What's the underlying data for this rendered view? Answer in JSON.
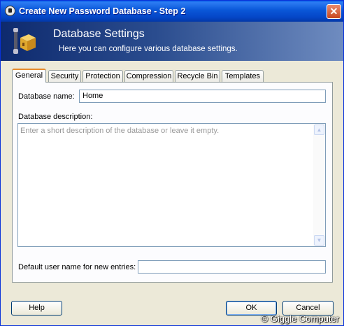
{
  "window": {
    "title": "Create New Password Database - Step 2",
    "close_label": "✕"
  },
  "banner": {
    "title": "Database Settings",
    "subtitle": "Here you can configure various database settings."
  },
  "tabs": [
    {
      "label": "General",
      "active": true
    },
    {
      "label": "Security"
    },
    {
      "label": "Protection"
    },
    {
      "label": "Compression"
    },
    {
      "label": "Recycle Bin"
    },
    {
      "label": "Templates"
    }
  ],
  "general": {
    "db_name_label": "Database name:",
    "db_name_value": "Home",
    "db_desc_label": "Database description:",
    "db_desc_placeholder": "Enter a short description of the database or leave it empty.",
    "default_user_label": "Default user name for new entries:",
    "default_user_value": ""
  },
  "buttons": {
    "help": "Help",
    "ok": "OK",
    "cancel": "Cancel"
  },
  "watermark": "© Giggle Computer",
  "colors": {
    "titlebar": "#0a57d8",
    "banner": "#2a4c8e",
    "active_tab_accent": "#e68b2c"
  }
}
